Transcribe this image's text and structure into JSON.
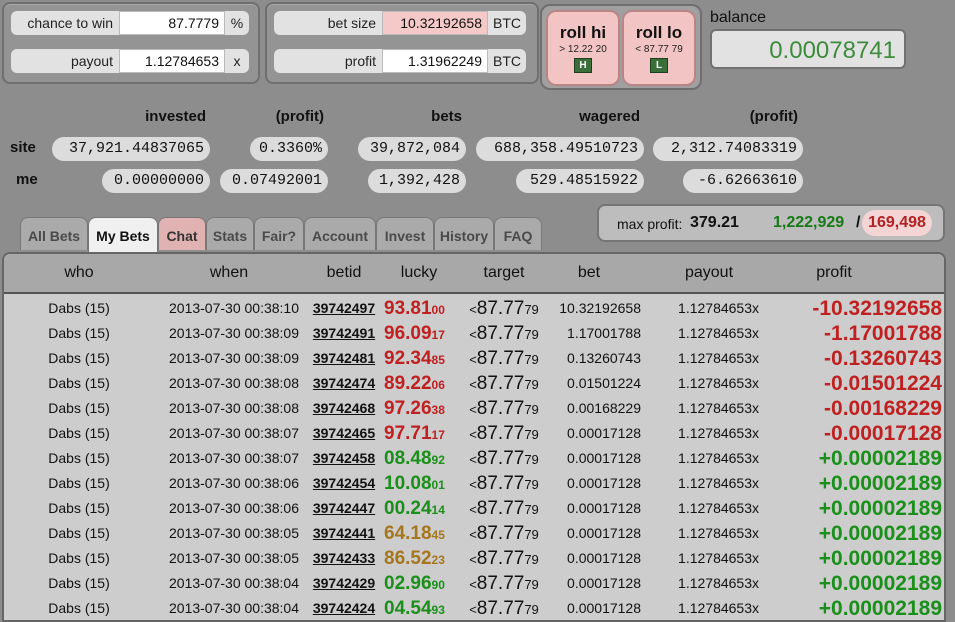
{
  "form": {
    "chance_label": "chance to win",
    "chance_value": "87.7779",
    "chance_unit": "%",
    "payout_label": "payout",
    "payout_value": "1.12784653",
    "payout_unit": "x",
    "betsize_label": "bet size",
    "betsize_value": "10.32192658",
    "betsize_unit": "BTC",
    "profit_label": "profit",
    "profit_value": "1.31962249",
    "profit_unit": "BTC"
  },
  "roll": {
    "hi_label": "roll hi",
    "hi_sub": "> 12.22 20",
    "hi_key": "H",
    "lo_label": "roll lo",
    "lo_sub": "< 87.77 79",
    "lo_key": "L"
  },
  "balance": {
    "label": "balance",
    "value": "0.00078741"
  },
  "stats": {
    "headers": {
      "invested": "invested",
      "profit1": "(profit)",
      "bets": "bets",
      "wagered": "wagered",
      "profit2": "(profit)"
    },
    "site": {
      "label": "site",
      "invested": "37,921.44837065",
      "profit1": "0.3360%",
      "bets": "39,872,084",
      "wagered": "688,358.49510723",
      "profit2": "2,312.74083319"
    },
    "me": {
      "label": "me",
      "invested": "0.00000000",
      "profit1": "0.07492001",
      "bets": "1,392,428",
      "wagered": "529.48515922",
      "profit2": "-6.62663610"
    }
  },
  "tabs": [
    "All Bets",
    "My Bets",
    "Chat",
    "Stats",
    "Fair?",
    "Account",
    "Invest",
    "History",
    "FAQ"
  ],
  "maxprofit": {
    "label": "max profit:",
    "value": "379.21",
    "wins": "1,222,929",
    "slash": "/",
    "losses": "169,498"
  },
  "table": {
    "headers": [
      "who",
      "when",
      "betid",
      "lucky",
      "target",
      "bet",
      "payout",
      "profit"
    ],
    "rows": [
      {
        "who": "Dabs (15)",
        "when": "2013-07-30 00:38:10",
        "betid": "39742497",
        "lucky_big": "93.81",
        "lucky_small": "00",
        "lucky_color": "red",
        "target_sym": "<",
        "target_big": "87.77",
        "target_small": "79",
        "bet": "10.32192658",
        "payout": "1.12784653x",
        "profit": "-10.32192658",
        "profit_color": "red"
      },
      {
        "who": "Dabs (15)",
        "when": "2013-07-30 00:38:09",
        "betid": "39742491",
        "lucky_big": "96.09",
        "lucky_small": "17",
        "lucky_color": "red",
        "target_sym": "<",
        "target_big": "87.77",
        "target_small": "79",
        "bet": "1.17001788",
        "payout": "1.12784653x",
        "profit": "-1.17001788",
        "profit_color": "red"
      },
      {
        "who": "Dabs (15)",
        "when": "2013-07-30 00:38:09",
        "betid": "39742481",
        "lucky_big": "92.34",
        "lucky_small": "85",
        "lucky_color": "red",
        "target_sym": "<",
        "target_big": "87.77",
        "target_small": "79",
        "bet": "0.13260743",
        "payout": "1.12784653x",
        "profit": "-0.13260743",
        "profit_color": "red"
      },
      {
        "who": "Dabs (15)",
        "when": "2013-07-30 00:38:08",
        "betid": "39742474",
        "lucky_big": "89.22",
        "lucky_small": "06",
        "lucky_color": "red",
        "target_sym": "<",
        "target_big": "87.77",
        "target_small": "79",
        "bet": "0.01501224",
        "payout": "1.12784653x",
        "profit": "-0.01501224",
        "profit_color": "red"
      },
      {
        "who": "Dabs (15)",
        "when": "2013-07-30 00:38:08",
        "betid": "39742468",
        "lucky_big": "97.26",
        "lucky_small": "38",
        "lucky_color": "red",
        "target_sym": "<",
        "target_big": "87.77",
        "target_small": "79",
        "bet": "0.00168229",
        "payout": "1.12784653x",
        "profit": "-0.00168229",
        "profit_color": "red"
      },
      {
        "who": "Dabs (15)",
        "when": "2013-07-30 00:38:07",
        "betid": "39742465",
        "lucky_big": "97.71",
        "lucky_small": "17",
        "lucky_color": "red",
        "target_sym": "<",
        "target_big": "87.77",
        "target_small": "79",
        "bet": "0.00017128",
        "payout": "1.12784653x",
        "profit": "-0.00017128",
        "profit_color": "red"
      },
      {
        "who": "Dabs (15)",
        "when": "2013-07-30 00:38:07",
        "betid": "39742458",
        "lucky_big": "08.48",
        "lucky_small": "92",
        "lucky_color": "green",
        "target_sym": "<",
        "target_big": "87.77",
        "target_small": "79",
        "bet": "0.00017128",
        "payout": "1.12784653x",
        "profit": "+0.00002189",
        "profit_color": "green"
      },
      {
        "who": "Dabs (15)",
        "when": "2013-07-30 00:38:06",
        "betid": "39742454",
        "lucky_big": "10.08",
        "lucky_small": "01",
        "lucky_color": "green",
        "target_sym": "<",
        "target_big": "87.77",
        "target_small": "79",
        "bet": "0.00017128",
        "payout": "1.12784653x",
        "profit": "+0.00002189",
        "profit_color": "green"
      },
      {
        "who": "Dabs (15)",
        "when": "2013-07-30 00:38:06",
        "betid": "39742447",
        "lucky_big": "00.24",
        "lucky_small": "14",
        "lucky_color": "green",
        "target_sym": "<",
        "target_big": "87.77",
        "target_small": "79",
        "bet": "0.00017128",
        "payout": "1.12784653x",
        "profit": "+0.00002189",
        "profit_color": "green"
      },
      {
        "who": "Dabs (15)",
        "when": "2013-07-30 00:38:05",
        "betid": "39742441",
        "lucky_big": "64.18",
        "lucky_small": "45",
        "lucky_color": "gold",
        "target_sym": "<",
        "target_big": "87.77",
        "target_small": "79",
        "bet": "0.00017128",
        "payout": "1.12784653x",
        "profit": "+0.00002189",
        "profit_color": "green"
      },
      {
        "who": "Dabs (15)",
        "when": "2013-07-30 00:38:05",
        "betid": "39742433",
        "lucky_big": "86.52",
        "lucky_small": "23",
        "lucky_color": "gold",
        "target_sym": "<",
        "target_big": "87.77",
        "target_small": "79",
        "bet": "0.00017128",
        "payout": "1.12784653x",
        "profit": "+0.00002189",
        "profit_color": "green"
      },
      {
        "who": "Dabs (15)",
        "when": "2013-07-30 00:38:04",
        "betid": "39742429",
        "lucky_big": "02.96",
        "lucky_small": "90",
        "lucky_color": "green",
        "target_sym": "<",
        "target_big": "87.77",
        "target_small": "79",
        "bet": "0.00017128",
        "payout": "1.12784653x",
        "profit": "+0.00002189",
        "profit_color": "green"
      },
      {
        "who": "Dabs (15)",
        "when": "2013-07-30 00:38:04",
        "betid": "39742424",
        "lucky_big": "04.54",
        "lucky_small": "93",
        "lucky_color": "green",
        "target_sym": "<",
        "target_big": "87.77",
        "target_small": "79",
        "bet": "0.00017128",
        "payout": "1.12784653x",
        "profit": "+0.00002189",
        "profit_color": "green"
      }
    ]
  }
}
